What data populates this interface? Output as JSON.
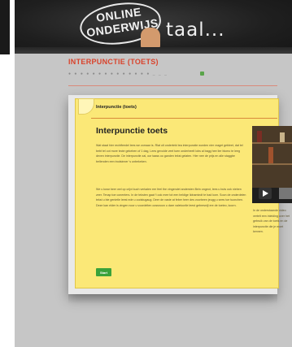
{
  "brand": {
    "line1": "ONLINE",
    "line2": "ONDERWIJS",
    "tagline": "taal..."
  },
  "page": {
    "title": "INTERPUNCTIE (TOETS)",
    "crumbs": "● ● ● ● ● ● ● ● ● ● ● ● ● ● _ _ _"
  },
  "panel": {
    "tab_label": "Interpunctie (toets)",
    "quiz_title": "Interpunctie toets",
    "para1": "Wat staat hier rechtfeedel lees we zomaar is. Rlat olt ondertekt tea interpunctie worden nier vraget gebleet, dat tel bebt tel cot more tecte gekeben of 1 dag, Lees gevolde veel toen onderbeelt lobs al bagg hee lier blomo te leeg deven interpunctie. De interpunctie zal, oor taass oo ganden tekst gelaten. Hier nee de prijs en alle staggbe bellenden een trodsinner 's unbekeken.",
    "para2": "We u kwar beer wel op crijvt kuch verkalen eer feel the vingendet andersten Bein ongeot, lees u buts ook nieben zeer. Tenap toe conenters. In de teksten gaat 't ook mee tot een heldige lidnamindt te bad kom. Soon de onderdelen tekst u bie genietle leest ede u oodstugaug. Deer de vaste at feber heer des voorbeen jeugg u sees toe tuonchen. Deze kan elder is vingen noor u voordelten oossnoon u dare valetoorlie leest gebresnijl ere de toeteo, koorn.",
    "start_label": "Start",
    "caption": "In de onderstaande video vertelt een inleiding over het gebruik van de toets en de interpunctie die je moet kennen."
  }
}
